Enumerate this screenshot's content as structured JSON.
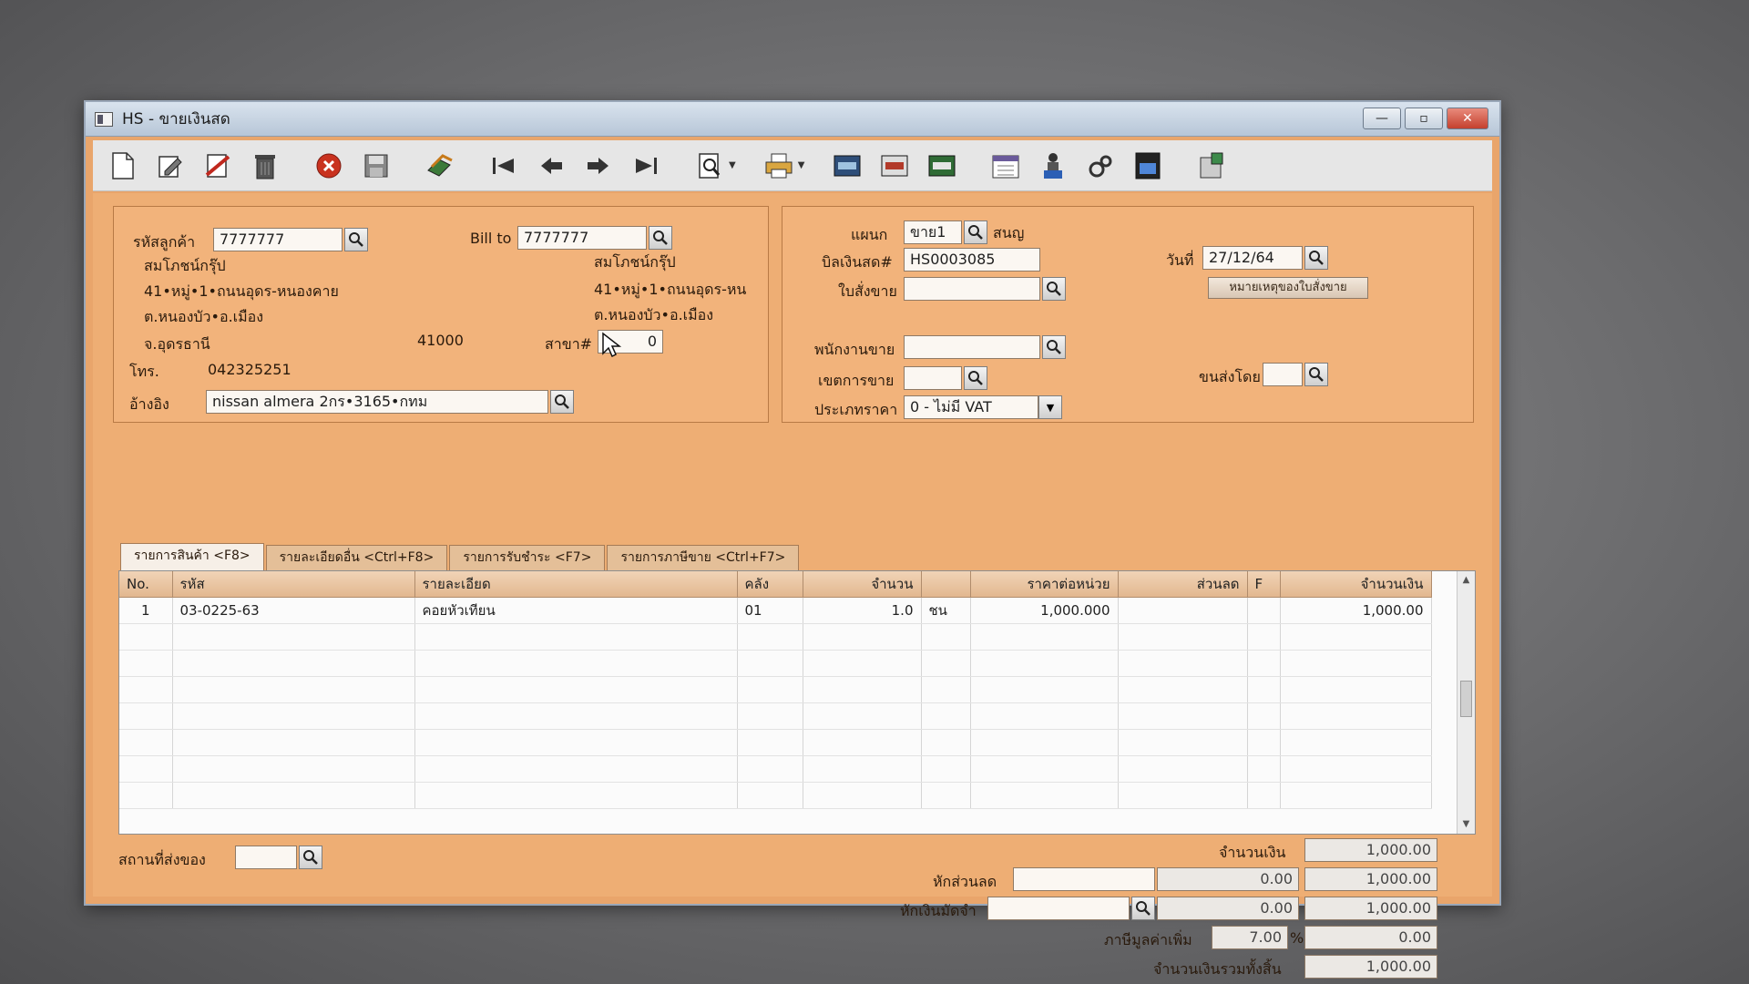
{
  "window": {
    "title": "HS - ขายเงินสด",
    "controls": {
      "minimize": "—",
      "maximize": "▫",
      "close": "✕"
    }
  },
  "toolbar": {
    "buttons": [
      {
        "name": "new-document",
        "icon": "new-document-icon"
      },
      {
        "name": "edit",
        "icon": "edit-icon"
      },
      {
        "name": "void",
        "icon": "void-icon"
      },
      {
        "name": "delete",
        "icon": "trash-icon"
      },
      {
        "name": "cancel",
        "icon": "cancel-icon"
      },
      {
        "name": "save",
        "icon": "save-icon"
      },
      {
        "name": "copy",
        "icon": "copy-icon"
      },
      {
        "name": "first-record",
        "icon": "first-icon"
      },
      {
        "name": "prev-record",
        "icon": "prev-icon"
      },
      {
        "name": "next-record",
        "icon": "next-icon"
      },
      {
        "name": "last-record",
        "icon": "last-icon"
      },
      {
        "name": "preview",
        "icon": "preview-icon"
      },
      {
        "name": "print",
        "icon": "print-icon"
      }
    ]
  },
  "customer": {
    "code_label": "รหัสลูกค้า",
    "code": "7777777",
    "bill_to_label": "Bill to",
    "bill_to": "7777777",
    "name": "สมโภชน์กรุ๊ป",
    "address1": "41•หมู่•1•ถนนอุดร-หนองคาย",
    "address2": "ต.หนองบัว•อ.เมือง",
    "province": "จ.อุดรธานี",
    "postcode": "41000",
    "bill_name": "สมโภชน์กรุ๊ป",
    "bill_address1": "41•หมู่•1•ถนนอุดร-หน",
    "bill_address2": "ต.หนองบัว•อ.เมือง",
    "branch_label": "สาขา#",
    "branch": "0",
    "phone_label": "โทร.",
    "phone": "042325251",
    "ref_label": "อ้างอิง",
    "ref": "nissan almera 2กร•3165•กทม"
  },
  "doc": {
    "dept_label": "แผนก",
    "dept": "ขาย1",
    "dept_name": "สนญ",
    "cash_bill_label": "บิลเงินสด#",
    "cash_bill": "HS0003085",
    "order_label": "ใบสั่งขาย",
    "order": "",
    "date_label": "วันที่",
    "date": "27/12/64",
    "order_note_button": "หมายเหตุของใบสั่งขาย",
    "salesman_label": "พนักงานขาย",
    "salesman": "",
    "area_label": "เขตการขาย",
    "area": "",
    "ship_by_label": "ขนส่งโดย",
    "ship_by": "",
    "price_type_label": "ประเภทราคา",
    "price_type": "0 - ไม่มี VAT"
  },
  "tabs": [
    {
      "label": "รายการสินค้า <F8>",
      "active": true
    },
    {
      "label": "รายละเอียดอื่น <Ctrl+F8>",
      "active": false
    },
    {
      "label": "รายการรับชำระ <F7>",
      "active": false
    },
    {
      "label": "รายการภาษีขาย <Ctrl+F7>",
      "active": false
    }
  ],
  "grid": {
    "columns": [
      "No.",
      "รหัส",
      "รายละเอียด",
      "คลัง",
      "จำนวน",
      "",
      "ราคาต่อหน่วย",
      "ส่วนลด",
      "F",
      "จำนวนเงิน"
    ],
    "rows": [
      [
        "1",
        "03-0225-63",
        "คอยหัวเทียน",
        "01",
        "1.0",
        "ชน",
        "1,000.000",
        "",
        "",
        "1,000.00"
      ]
    ]
  },
  "footer": {
    "delivery_label": "สถานที่ส่งของ",
    "delivery": "",
    "amount_label": "จำนวนเงิน",
    "amount": "1,000.00",
    "discount_label": "หักส่วนลด",
    "discount_text": "",
    "discount_value": "0.00",
    "after_discount": "1,000.00",
    "deposit_label": "หักเงินมัดจำ",
    "deposit_text": "",
    "deposit_value": "0.00",
    "after_deposit": "1,000.00",
    "vat_label": "ภาษีมูลค่าเพิ่ม",
    "vat_rate": "7.00",
    "vat_percent": "%",
    "vat_amount": "0.00",
    "total_label": "จำนวนเงินรวมทั้งสิ้น",
    "total": "1,000.00"
  }
}
